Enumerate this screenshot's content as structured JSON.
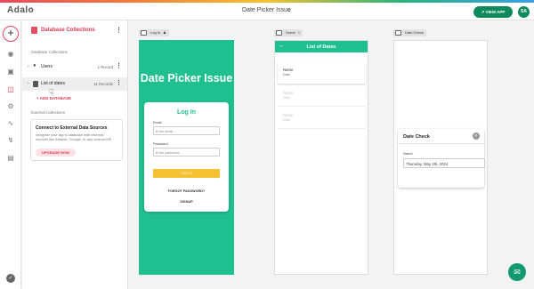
{
  "header": {
    "logo": "Adalo",
    "app_title": "Date Picker Issue",
    "view_app_label": "↗ VIEW APP",
    "avatar_initials": "SA"
  },
  "sidebar": {
    "title": "Database Collections",
    "section_collections": "Database Collections",
    "collections": [
      {
        "name": "Users",
        "count": "1 Record"
      },
      {
        "name": "List of dates",
        "count": "11 Records"
      }
    ],
    "add_database": "+ ADD DATABASE",
    "section_external": "External Collections",
    "external_title": "Connect to External Data Sources",
    "external_desc": "Integrate your app's database with external sources like Airtable, Google, or any custom API.",
    "upgrade_label": "UPGRADE NOW"
  },
  "screens": {
    "login": {
      "label": "Log In",
      "title": "Date Picker Issue",
      "card_title": "Log In",
      "email_label": "Email",
      "email_placeholder": "Enter email...",
      "password_label": "Password",
      "password_placeholder": "Enter password...",
      "login_button": "LOG IN",
      "forgot": "FORGOT PASSWORD?",
      "signup": "SIGNUP"
    },
    "home": {
      "label": "Home",
      "header_title": "List of Dates",
      "items": [
        {
          "name": "Name",
          "date": "Date"
        },
        {
          "name": "Name",
          "date": "Date"
        },
        {
          "name": "Name",
          "date": "Date"
        }
      ]
    },
    "date_check": {
      "label": "Date Check",
      "card_title": "Date Check",
      "field_label": "Name",
      "field_value": "Thursday, May 4th, 2024"
    }
  },
  "colors": {
    "brand_green": "#1fbf8f",
    "accent_red": "#d9374f",
    "button_yellow": "#f5c133"
  }
}
